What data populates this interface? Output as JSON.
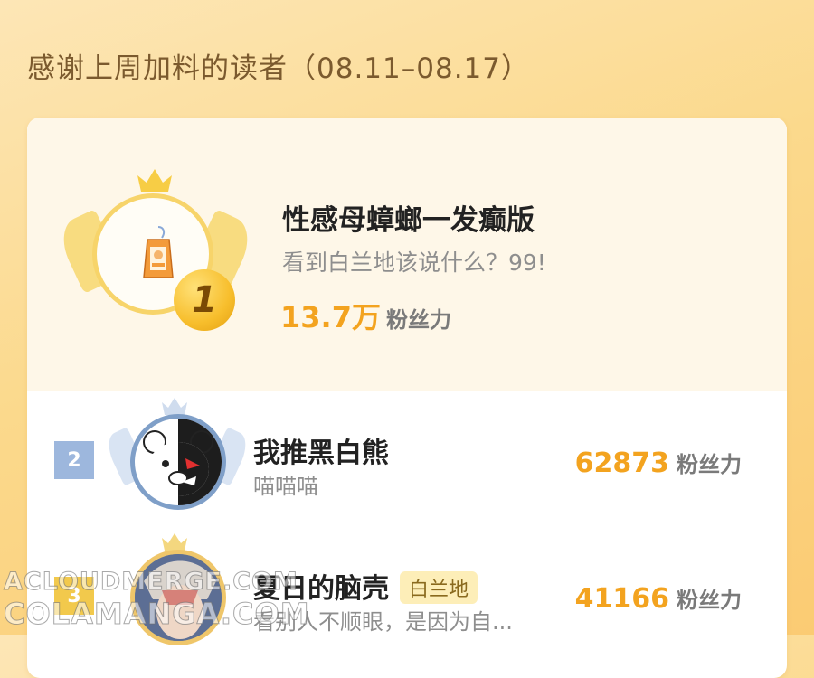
{
  "header": {
    "title": "感谢上周加料的读者（08.11–08.17）"
  },
  "top_reader": {
    "rank": "1",
    "name": "性感母蟑螂一发癫版",
    "subtitle": "看到白兰地该说什么？99!",
    "fans_value": "13.7万",
    "fans_unit": "粉丝力",
    "icons": [
      "crown-icon",
      "wing-icon",
      "charm-avatar-icon"
    ]
  },
  "list": [
    {
      "rank": "2",
      "name": "我推黑白熊",
      "subtitle": "喵喵喵",
      "tag": "",
      "fans_value": "62873",
      "fans_unit": "粉丝力"
    },
    {
      "rank": "3",
      "name": "夏日的脑壳",
      "subtitle": "看别人不顺眼，是因为自...",
      "tag": "白兰地",
      "fans_value": "41166",
      "fans_unit": "粉丝力"
    }
  ],
  "watermark": {
    "line1": "ACLOUDMERGE.COM",
    "line2": "COLAMANGA.COM"
  },
  "colors": {
    "accent": "#f3a31f",
    "background": "#fbd98c",
    "rank2": "#9db7dd",
    "gold": "#f2c94c"
  }
}
